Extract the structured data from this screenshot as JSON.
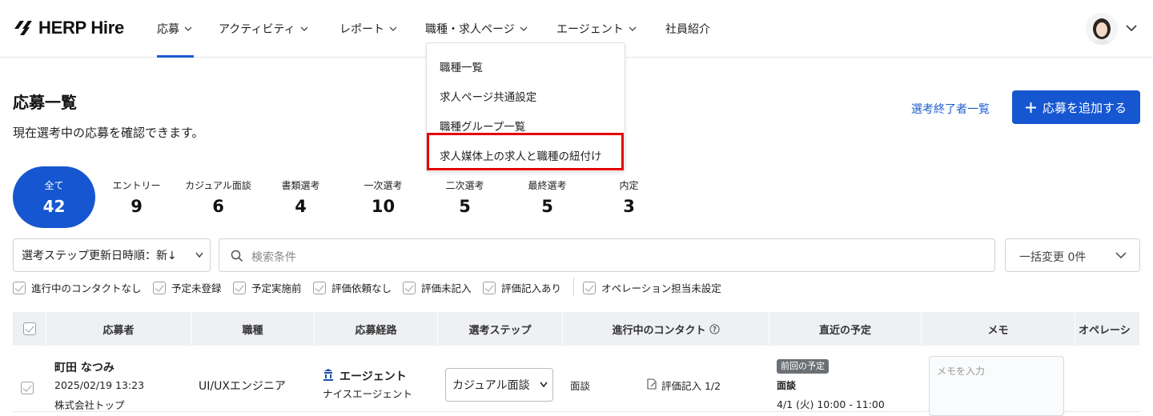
{
  "header": {
    "logo_text": "HERP Hire",
    "nav": [
      {
        "label": "応募"
      },
      {
        "label": "アクティビティ"
      },
      {
        "label": "レポート"
      },
      {
        "label": "職種・求人ページ"
      },
      {
        "label": "エージェント"
      },
      {
        "label": "社員紹介"
      }
    ]
  },
  "dropdown": {
    "items": [
      {
        "label": "職種一覧"
      },
      {
        "label": "求人ページ共通設定"
      },
      {
        "label": "職種グループ一覧"
      },
      {
        "label": "求人媒体上の求人と職種の紐付け"
      }
    ]
  },
  "page": {
    "title": "応募一覧",
    "description": "現在選考中の応募を確認できます。",
    "finished_link": "選考終了者一覧",
    "add_button": "応募を追加する"
  },
  "stages": [
    {
      "label": "全て",
      "count": "42"
    },
    {
      "label": "エントリー",
      "count": "9"
    },
    {
      "label": "カジュアル面談",
      "count": "6"
    },
    {
      "label": "書類選考",
      "count": "4"
    },
    {
      "label": "一次選考",
      "count": "10"
    },
    {
      "label": "二次選考",
      "count": "5"
    },
    {
      "label": "最終選考",
      "count": "5"
    },
    {
      "label": "内定",
      "count": "3"
    }
  ],
  "filters": {
    "sort_value": "選考ステップ更新日時順：新↓",
    "search_placeholder": "検索条件",
    "bulk_change": "一括変更 0件",
    "checkboxes": [
      {
        "label": "進行中のコンタクトなし"
      },
      {
        "label": "予定未登録"
      },
      {
        "label": "予定実施前"
      },
      {
        "label": "評価依頼なし"
      },
      {
        "label": "評価未記入"
      },
      {
        "label": "評価記入あり"
      },
      {
        "label": "オペレーション担当未設定"
      }
    ]
  },
  "table": {
    "headers": [
      "応募者",
      "職種",
      "応募経路",
      "選考ステップ",
      "進行中のコンタクト",
      "直近の予定",
      "メモ",
      "オペレーシ"
    ],
    "row": {
      "name": "町田 なつみ",
      "datetime": "2025/02/19 13:23",
      "company": "株式会社トップ",
      "job": "UI/UXエンジニア",
      "route": "エージェント",
      "route_sub": "ナイスエージェント",
      "step": "カジュアル面談",
      "contact_type": "面談",
      "evaluation": "評価記入 1/2",
      "prev_badge": "前回の予定",
      "schedule_type": "面談",
      "schedule_time": "4/1 (火) 10:00 - 11:00",
      "memo_placeholder": "メモを入力"
    }
  },
  "colors": {
    "primary": "#1656d0",
    "highlight_border": "#e50000"
  }
}
